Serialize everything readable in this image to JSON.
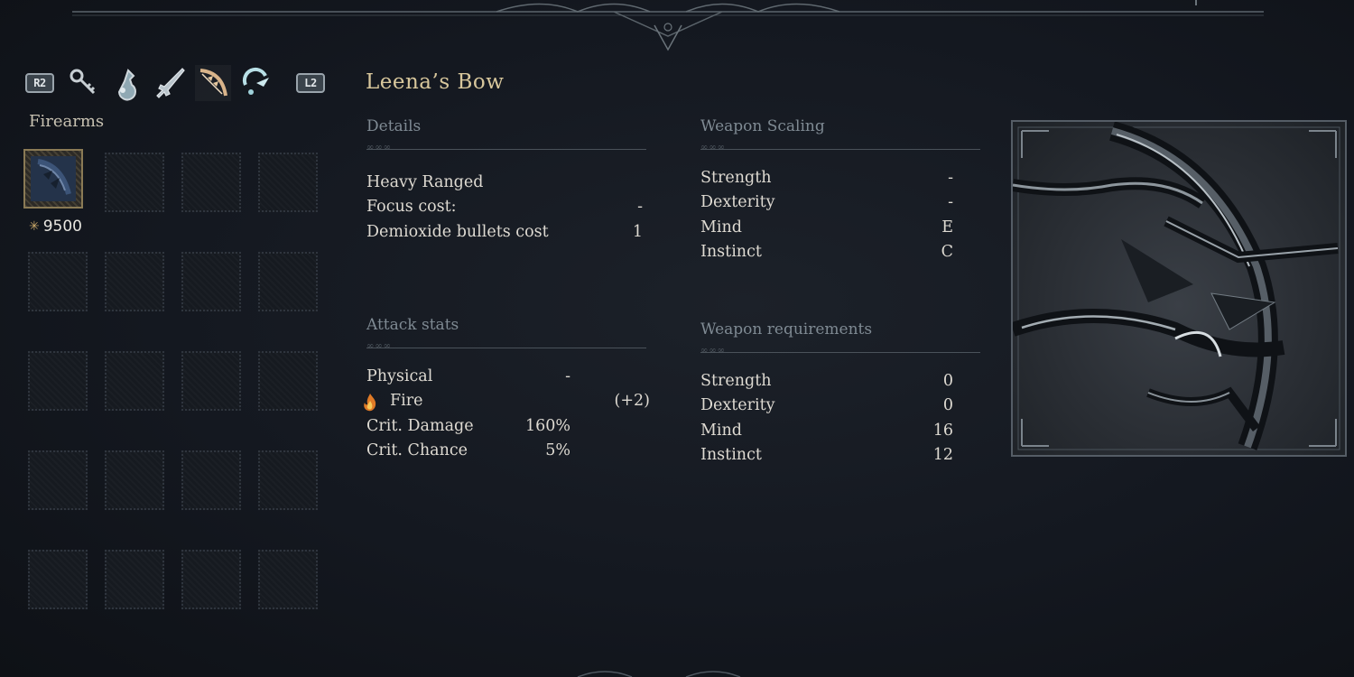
{
  "category_bar": {
    "left_button": "R2",
    "right_button": "L2",
    "icons": [
      "key-icon",
      "flask-icon",
      "sword-icon",
      "bow-icon",
      "ring-icon"
    ],
    "active_index": 3
  },
  "section": {
    "label": "Firearms"
  },
  "inventory": {
    "selected_item_cost": "9500",
    "cost_icon": "star-icon"
  },
  "weapon": {
    "name": "Leena’s Bow"
  },
  "details": {
    "heading": "Details",
    "rows": [
      {
        "label": "Heavy Ranged",
        "value": ""
      },
      {
        "label": "Focus cost:",
        "value": "-"
      },
      {
        "label": "Demioxide bullets cost",
        "value": "1"
      }
    ]
  },
  "attack_stats": {
    "heading": "Attack stats",
    "rows": [
      {
        "label": "Physical",
        "value": "-",
        "extra": ""
      },
      {
        "label": "Fire",
        "value": "",
        "extra": "(+2)",
        "icon": "fire-icon"
      },
      {
        "label": "Crit. Damage",
        "value": "160%",
        "extra": ""
      },
      {
        "label": "Crit. Chance",
        "value": "5%",
        "extra": ""
      }
    ]
  },
  "weapon_scaling": {
    "heading": "Weapon Scaling",
    "rows": [
      {
        "label": "Strength",
        "value": "-"
      },
      {
        "label": "Dexterity",
        "value": "-"
      },
      {
        "label": "Mind",
        "value": "E"
      },
      {
        "label": "Instinct",
        "value": "C"
      }
    ]
  },
  "weapon_requirements": {
    "heading": "Weapon requirements",
    "rows": [
      {
        "label": "Strength",
        "value": "0"
      },
      {
        "label": "Dexterity",
        "value": "0"
      },
      {
        "label": "Mind",
        "value": "16"
      },
      {
        "label": "Instinct",
        "value": "12"
      }
    ]
  },
  "colors": {
    "title": "#d8c79c",
    "heading": "#7f8a93",
    "text": "#dedad2",
    "background": "#141820"
  }
}
